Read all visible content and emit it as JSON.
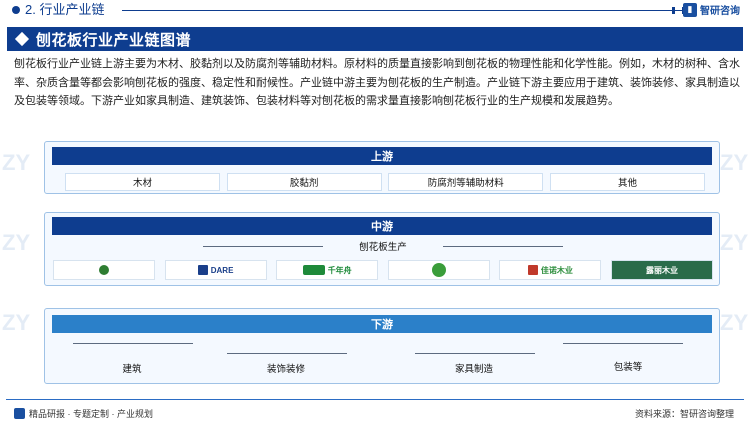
{
  "header": {
    "section_title": "2. 行业产业链",
    "brand_name": "智研咨询",
    "brand_logo": "chart-logo-icon"
  },
  "title": "刨花板行业产业链图谱",
  "intro": "刨花板行业产业链上游主要为木材、胶黏剂以及防腐剂等辅助材料。原材料的质量直接影响到刨花板的物理性能和化学性能。例如，木材的树种、含水率、杂质含量等都会影响刨花板的强度、稳定性和耐候性。产业链中游主要为刨花板的生产制造。产业链下游主要应用于建筑、装饰装修、家具制造以及包装等领域。下游产业如家具制造、建筑装饰、包装材料等对刨花板的需求量直接影响刨花板行业的生产规模和发展趋势。",
  "upstream": {
    "label": "上游",
    "items": [
      "木材",
      "胶黏剂",
      "防腐剂等辅助材料",
      "其他"
    ]
  },
  "midstream": {
    "label": "中游",
    "sub_label": "刨花板生产",
    "logos": [
      {
        "text": "",
        "color": "#2e7d32"
      },
      {
        "text": "DARE",
        "color": "#1a3f8a"
      },
      {
        "text": "千年舟",
        "color": "#1e8a3a"
      },
      {
        "text": "",
        "color": "#3a9d3a"
      },
      {
        "text": "佳诺木业",
        "color": "#2f8f3f"
      },
      {
        "text": "露丽木业",
        "color": "#2a6b4a"
      }
    ]
  },
  "downstream": {
    "label": "下游",
    "items": [
      "建筑",
      "装饰装修",
      "家具制造",
      "包装等"
    ]
  },
  "footer": {
    "slogan": "精品研报 · 专题定制 · 产业规划",
    "source": "资料来源：智研咨询整理"
  },
  "colors": {
    "primary": "#0e3d8f",
    "downstream_head": "#2b80c9",
    "panel_bg": "#f4f9ff",
    "panel_border": "#9fc2e6"
  }
}
